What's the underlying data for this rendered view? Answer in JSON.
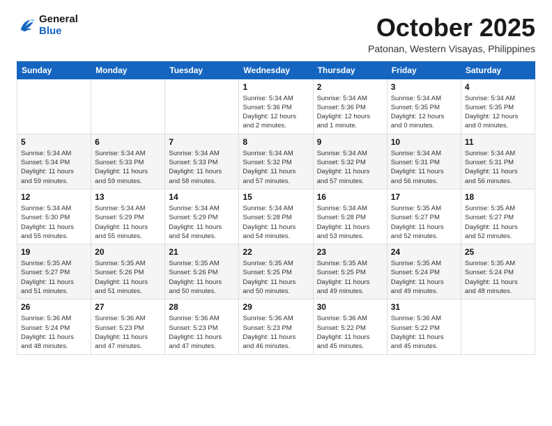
{
  "logo": {
    "line1": "General",
    "line2": "Blue"
  },
  "title": "October 2025",
  "location": "Patonan, Western Visayas, Philippines",
  "weekdays": [
    "Sunday",
    "Monday",
    "Tuesday",
    "Wednesday",
    "Thursday",
    "Friday",
    "Saturday"
  ],
  "weeks": [
    [
      {
        "day": "",
        "info": ""
      },
      {
        "day": "",
        "info": ""
      },
      {
        "day": "",
        "info": ""
      },
      {
        "day": "1",
        "info": "Sunrise: 5:34 AM\nSunset: 5:36 PM\nDaylight: 12 hours\nand 2 minutes."
      },
      {
        "day": "2",
        "info": "Sunrise: 5:34 AM\nSunset: 5:36 PM\nDaylight: 12 hours\nand 1 minute."
      },
      {
        "day": "3",
        "info": "Sunrise: 5:34 AM\nSunset: 5:35 PM\nDaylight: 12 hours\nand 0 minutes."
      },
      {
        "day": "4",
        "info": "Sunrise: 5:34 AM\nSunset: 5:35 PM\nDaylight: 12 hours\nand 0 minutes."
      }
    ],
    [
      {
        "day": "5",
        "info": "Sunrise: 5:34 AM\nSunset: 5:34 PM\nDaylight: 11 hours\nand 59 minutes."
      },
      {
        "day": "6",
        "info": "Sunrise: 5:34 AM\nSunset: 5:33 PM\nDaylight: 11 hours\nand 59 minutes."
      },
      {
        "day": "7",
        "info": "Sunrise: 5:34 AM\nSunset: 5:33 PM\nDaylight: 11 hours\nand 58 minutes."
      },
      {
        "day": "8",
        "info": "Sunrise: 5:34 AM\nSunset: 5:32 PM\nDaylight: 11 hours\nand 57 minutes."
      },
      {
        "day": "9",
        "info": "Sunrise: 5:34 AM\nSunset: 5:32 PM\nDaylight: 11 hours\nand 57 minutes."
      },
      {
        "day": "10",
        "info": "Sunrise: 5:34 AM\nSunset: 5:31 PM\nDaylight: 11 hours\nand 56 minutes."
      },
      {
        "day": "11",
        "info": "Sunrise: 5:34 AM\nSunset: 5:31 PM\nDaylight: 11 hours\nand 56 minutes."
      }
    ],
    [
      {
        "day": "12",
        "info": "Sunrise: 5:34 AM\nSunset: 5:30 PM\nDaylight: 11 hours\nand 55 minutes."
      },
      {
        "day": "13",
        "info": "Sunrise: 5:34 AM\nSunset: 5:29 PM\nDaylight: 11 hours\nand 55 minutes."
      },
      {
        "day": "14",
        "info": "Sunrise: 5:34 AM\nSunset: 5:29 PM\nDaylight: 11 hours\nand 54 minutes."
      },
      {
        "day": "15",
        "info": "Sunrise: 5:34 AM\nSunset: 5:28 PM\nDaylight: 11 hours\nand 54 minutes."
      },
      {
        "day": "16",
        "info": "Sunrise: 5:34 AM\nSunset: 5:28 PM\nDaylight: 11 hours\nand 53 minutes."
      },
      {
        "day": "17",
        "info": "Sunrise: 5:35 AM\nSunset: 5:27 PM\nDaylight: 11 hours\nand 52 minutes."
      },
      {
        "day": "18",
        "info": "Sunrise: 5:35 AM\nSunset: 5:27 PM\nDaylight: 11 hours\nand 52 minutes."
      }
    ],
    [
      {
        "day": "19",
        "info": "Sunrise: 5:35 AM\nSunset: 5:27 PM\nDaylight: 11 hours\nand 51 minutes."
      },
      {
        "day": "20",
        "info": "Sunrise: 5:35 AM\nSunset: 5:26 PM\nDaylight: 11 hours\nand 51 minutes."
      },
      {
        "day": "21",
        "info": "Sunrise: 5:35 AM\nSunset: 5:26 PM\nDaylight: 11 hours\nand 50 minutes."
      },
      {
        "day": "22",
        "info": "Sunrise: 5:35 AM\nSunset: 5:25 PM\nDaylight: 11 hours\nand 50 minutes."
      },
      {
        "day": "23",
        "info": "Sunrise: 5:35 AM\nSunset: 5:25 PM\nDaylight: 11 hours\nand 49 minutes."
      },
      {
        "day": "24",
        "info": "Sunrise: 5:35 AM\nSunset: 5:24 PM\nDaylight: 11 hours\nand 49 minutes."
      },
      {
        "day": "25",
        "info": "Sunrise: 5:35 AM\nSunset: 5:24 PM\nDaylight: 11 hours\nand 48 minutes."
      }
    ],
    [
      {
        "day": "26",
        "info": "Sunrise: 5:36 AM\nSunset: 5:24 PM\nDaylight: 11 hours\nand 48 minutes."
      },
      {
        "day": "27",
        "info": "Sunrise: 5:36 AM\nSunset: 5:23 PM\nDaylight: 11 hours\nand 47 minutes."
      },
      {
        "day": "28",
        "info": "Sunrise: 5:36 AM\nSunset: 5:23 PM\nDaylight: 11 hours\nand 47 minutes."
      },
      {
        "day": "29",
        "info": "Sunrise: 5:36 AM\nSunset: 5:23 PM\nDaylight: 11 hours\nand 46 minutes."
      },
      {
        "day": "30",
        "info": "Sunrise: 5:36 AM\nSunset: 5:22 PM\nDaylight: 11 hours\nand 45 minutes."
      },
      {
        "day": "31",
        "info": "Sunrise: 5:36 AM\nSunset: 5:22 PM\nDaylight: 11 hours\nand 45 minutes."
      },
      {
        "day": "",
        "info": ""
      }
    ]
  ]
}
